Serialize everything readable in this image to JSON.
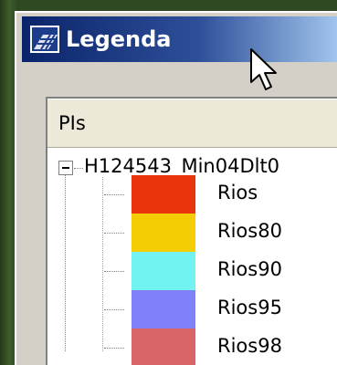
{
  "window": {
    "title": "Legenda",
    "icon": "map-layer-icon"
  },
  "panel": {
    "column_header": "PIs",
    "tree": {
      "root_label": "H124543_Min04Dlt0",
      "expanded": true,
      "items": [
        {
          "label": "Rios",
          "color": "#e8350c"
        },
        {
          "label": "Rios80",
          "color": "#f5cd05"
        },
        {
          "label": "Rios90",
          "color": "#73f2f2"
        },
        {
          "label": "Rios95",
          "color": "#8080f8"
        },
        {
          "label": "Rios98",
          "color": "#d96468"
        }
      ]
    }
  }
}
